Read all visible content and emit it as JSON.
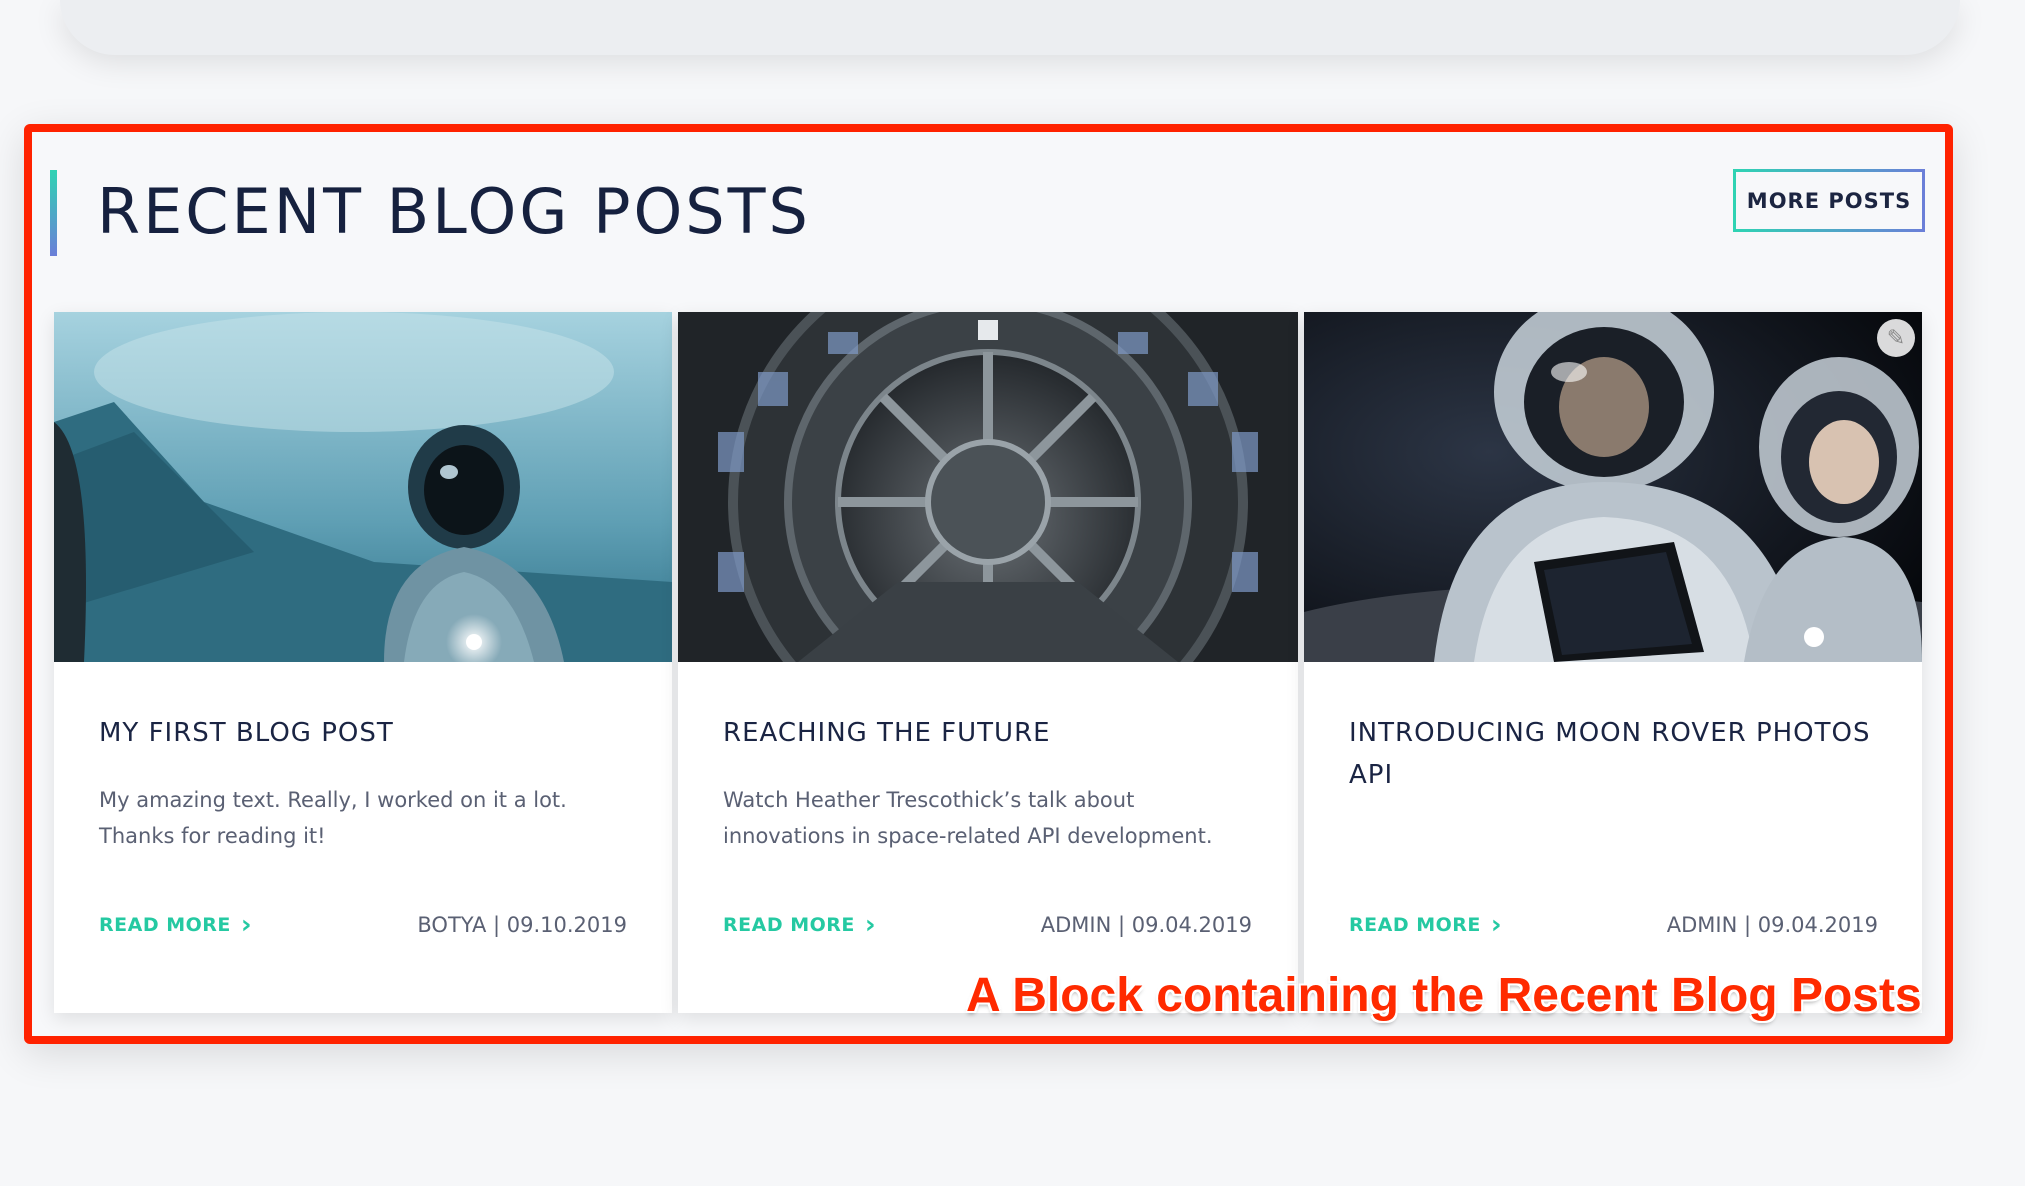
{
  "section": {
    "title": "RECENT BLOG POSTS",
    "more_button": "MORE POSTS"
  },
  "posts": [
    {
      "title": "MY FIRST BLOG POST",
      "excerpt": "My amazing text. Really, I worked on it a lot. Thanks for reading it!",
      "read_more": "READ MORE",
      "meta": "BOTYA | 09.10.2019",
      "image": "astronaut-on-misty-planet"
    },
    {
      "title": "REACHING THE FUTURE",
      "excerpt": "Watch Heather Trescothick’s talk about innovations in space-related API development.",
      "read_more": "READ MORE",
      "meta": "ADMIN | 09.04.2019",
      "image": "spaceship-circular-door"
    },
    {
      "title": "INTRODUCING MOON ROVER PHOTOS API",
      "excerpt": "",
      "read_more": "READ MORE",
      "meta": "ADMIN | 09.04.2019",
      "image": "two-astronauts-with-tablet"
    }
  ],
  "annotation": {
    "label": "A Block containing the Recent Blog Posts",
    "color": "#ff2200"
  },
  "colors": {
    "accent_teal": "#25c9a2",
    "heading_navy": "#16213f"
  }
}
